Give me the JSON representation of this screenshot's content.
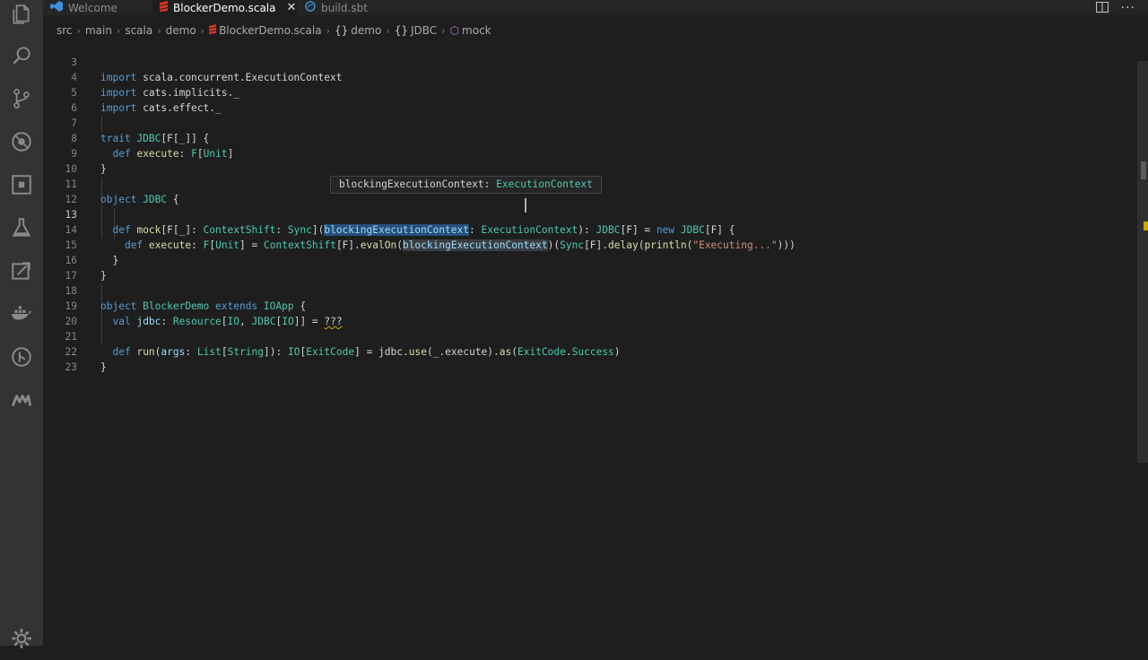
{
  "tabs": [
    {
      "label": "Welcome",
      "icon": "vscode-icon",
      "active": false
    },
    {
      "label": "BlockerDemo.scala",
      "icon": "scala-icon",
      "active": true,
      "close": "✕"
    },
    {
      "label": "build.sbt",
      "icon": "sbt-icon",
      "active": false
    }
  ],
  "breadcrumb": [
    {
      "label": "src"
    },
    {
      "label": "main"
    },
    {
      "label": "scala"
    },
    {
      "label": "demo"
    },
    {
      "label": "BlockerDemo.scala",
      "icon": "scala-icon"
    },
    {
      "label": "demo",
      "icon": "namespace-icon",
      "glyph": "{}"
    },
    {
      "label": "JDBC",
      "icon": "namespace-icon",
      "glyph": "{}"
    },
    {
      "label": "mock",
      "icon": "method-icon",
      "glyph": "⬡"
    }
  ],
  "hover": {
    "name": "blockingExecutionContext:",
    "type": "ExecutionContext"
  },
  "lines": [
    {
      "n": "3"
    },
    {
      "n": "4"
    },
    {
      "n": "5"
    },
    {
      "n": "6"
    },
    {
      "n": "7"
    },
    {
      "n": "8"
    },
    {
      "n": "9"
    },
    {
      "n": "10"
    },
    {
      "n": "11"
    },
    {
      "n": "12"
    },
    {
      "n": "13"
    },
    {
      "n": "14"
    },
    {
      "n": "15"
    },
    {
      "n": "16"
    },
    {
      "n": "17"
    },
    {
      "n": "18"
    },
    {
      "n": "19"
    },
    {
      "n": "20"
    },
    {
      "n": "21"
    },
    {
      "n": "22"
    },
    {
      "n": "23"
    }
  ],
  "code": {
    "l3": [
      "import",
      "scala.concurrent.ExecutionContext"
    ],
    "l4": [
      "import",
      "cats.implicits._"
    ],
    "l5": [
      "import",
      "cats.effect._"
    ],
    "l7": [
      "trait",
      "JDBC",
      "[F[_]] {"
    ],
    "l8": [
      "def",
      "execute",
      ":",
      "F",
      "[",
      "Unit",
      "]"
    ],
    "l9": [
      "}"
    ],
    "l11": [
      "object",
      "JDBC",
      "{"
    ],
    "l13": [
      "def",
      "mock",
      "[F[_]:",
      "ContextShift",
      ":",
      "Sync",
      "](",
      "blockingExecutionContext",
      ":",
      "ExecutionContext",
      "):",
      "JDBC",
      "[F] =",
      "new",
      "JDBC",
      "[F] {"
    ],
    "l14": [
      "def",
      "execute",
      ":",
      "F",
      "[",
      "Unit",
      "] =",
      "ContextShift",
      "[F].",
      "evalOn",
      "(",
      "blockingExecutionContext",
      ")(",
      "Sync",
      "[F].",
      "delay",
      "(",
      "println",
      "(",
      "\"Executing...\"",
      ")))"
    ],
    "l15": [
      "}"
    ],
    "l16": [
      "}"
    ],
    "l18": [
      "object",
      "BlockerDemo",
      "extends",
      "IOApp",
      "{"
    ],
    "l19": [
      "val",
      "jdbc",
      ":",
      "Resource",
      "[",
      "IO",
      ",",
      "JDBC",
      "[",
      "IO",
      "]] =",
      "???"
    ],
    "l21": [
      "def",
      "run",
      "(",
      "args",
      ":",
      "List",
      "[",
      "String",
      "]):",
      "IO",
      "[",
      "ExitCode",
      "] = jdbc.",
      "use",
      "(_.execute).",
      "as",
      "(",
      "ExitCode",
      ".",
      "Success",
      ")"
    ],
    "l22": [
      "}"
    ]
  }
}
